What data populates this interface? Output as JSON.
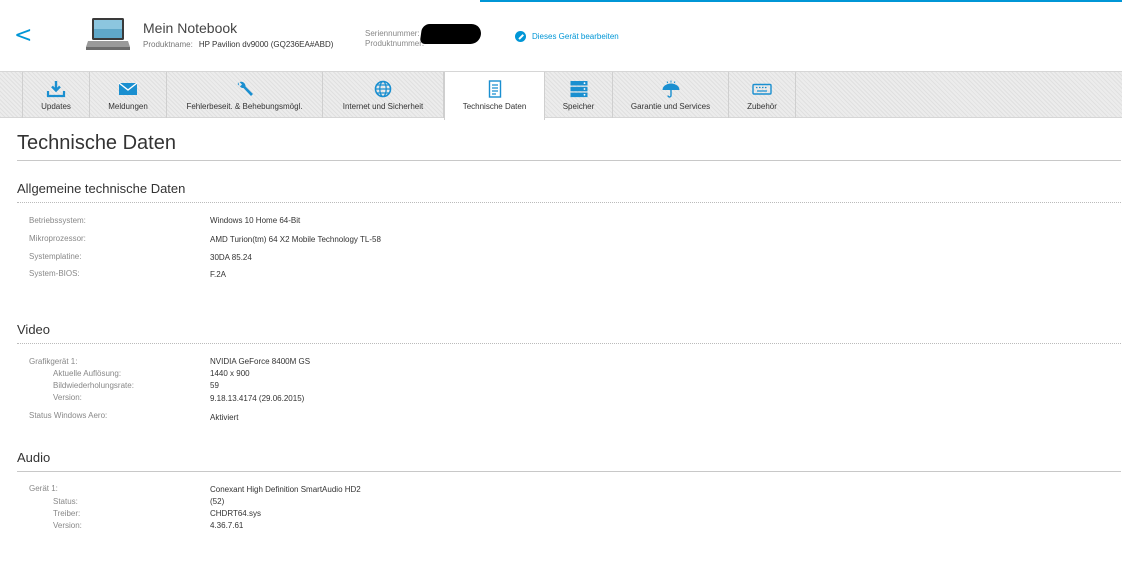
{
  "header": {
    "back_label": "<",
    "device_title": "Mein Notebook",
    "product_label": "Produktname:",
    "product_value": "HP Pavilion dv9000 (GQ236EA#ABD)",
    "serial_label": "Seriennummer:",
    "product_number_label": "Produktnummer:",
    "edit_label": "Dieses Gerät bearbeiten"
  },
  "tabs": [
    {
      "label": "Updates",
      "icon": "download-icon"
    },
    {
      "label": "Meldungen",
      "icon": "envelope-icon"
    },
    {
      "label": "Fehlerbeseit. & Behebungsmögl.",
      "icon": "wrench-icon"
    },
    {
      "label": "Internet und Sicherheit",
      "icon": "globe-icon"
    },
    {
      "label": "Technische Daten",
      "icon": "document-icon",
      "active": true
    },
    {
      "label": "Speicher",
      "icon": "storage-icon"
    },
    {
      "label": "Garantie und Services",
      "icon": "umbrella-icon"
    },
    {
      "label": "Zubehör",
      "icon": "keyboard-icon"
    }
  ],
  "page_title": "Technische Daten",
  "sections": {
    "general": {
      "title": "Allgemeine technische Daten",
      "rows": [
        {
          "label": "Betriebssystem:",
          "value": "Windows 10 Home 64-Bit"
        },
        {
          "label": "Mikroprozessor:",
          "value": "AMD Turion(tm) 64 X2 Mobile Technology TL-58"
        },
        {
          "label": "Systemplatine:",
          "value": "30DA 85.24"
        },
        {
          "label": "System-BIOS:",
          "value": "F.2A"
        }
      ]
    },
    "video": {
      "title": "Video",
      "rows": [
        {
          "label": "Grafikgerät 1:",
          "value": "NVIDIA GeForce 8400M GS"
        },
        {
          "label": "Aktuelle Auflösung:",
          "value": "1440 x 900"
        },
        {
          "label": "Bildwiederholungsrate:",
          "value": "59"
        },
        {
          "label": "Version:",
          "value": "9.18.13.4174 (29.06.2015)"
        },
        {
          "label": "Status Windows Aero:",
          "value": "Aktiviert"
        }
      ]
    },
    "audio": {
      "title": "Audio",
      "rows": [
        {
          "label": "Gerät 1:",
          "value": "Conexant High Definition SmartAudio HD2"
        },
        {
          "label": "Status:",
          "value": "(52)"
        },
        {
          "label": "Treiber:",
          "value": "CHDRT64.sys"
        },
        {
          "label": "Version:",
          "value": "4.36.7.61"
        }
      ]
    }
  },
  "colors": {
    "accent": "#0096d6",
    "icon_blue": "#1a8fd0"
  }
}
